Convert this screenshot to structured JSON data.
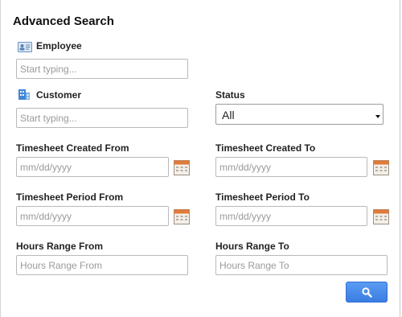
{
  "title": "Advanced Search",
  "employee": {
    "label": "Employee",
    "placeholder": "Start typing...",
    "icon": "employee-card-icon"
  },
  "customer": {
    "label": "Customer",
    "placeholder": "Start typing...",
    "icon": "building-icon"
  },
  "status": {
    "label": "Status",
    "selected": "All"
  },
  "timesheet_created_from": {
    "label": "Timesheet Created From",
    "placeholder": "mm/dd/yyyy"
  },
  "timesheet_created_to": {
    "label": "Timesheet Created To",
    "placeholder": "mm/dd/yyyy"
  },
  "timesheet_period_from": {
    "label": "Timesheet Period From",
    "placeholder": "mm/dd/yyyy"
  },
  "timesheet_period_to": {
    "label": "Timesheet Period To",
    "placeholder": "mm/dd/yyyy"
  },
  "hours_range_from": {
    "label": "Hours Range From",
    "placeholder": "Hours Range From"
  },
  "hours_range_to": {
    "label": "Hours Range To",
    "placeholder": "Hours Range To"
  },
  "search_button": {
    "icon": "search-icon"
  },
  "colors": {
    "button_blue": "#3a7de3",
    "calendar_orange": "#e07b39"
  }
}
